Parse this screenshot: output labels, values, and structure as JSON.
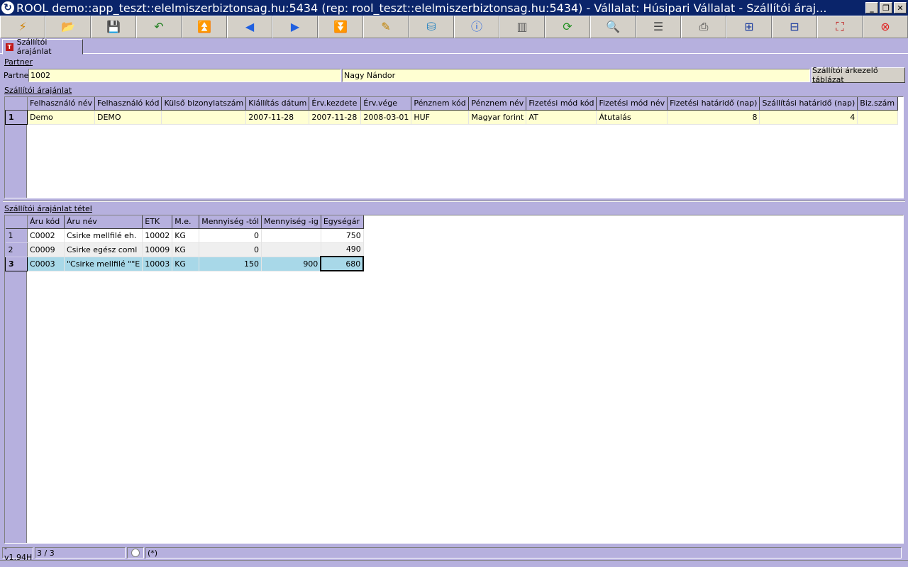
{
  "window": {
    "title": "ROOL demo::app_teszt::elelmiszerbiztonsag.hu:5434 (rep: rool_teszt::elelmiszerbiztonsag.hu:5434) - Vállalat: Húsipari Vállalat - Szállítói áraj...",
    "minimize": "_",
    "restore": "❐",
    "close": "✕"
  },
  "toolbar": [
    {
      "name": "wizard-icon",
      "glyph": "⚡",
      "color": "#d08000"
    },
    {
      "name": "open-folder-icon",
      "glyph": "📂",
      "color": "#2060c0"
    },
    {
      "name": "save-icon",
      "glyph": "💾",
      "color": "#204080"
    },
    {
      "name": "undo-icon",
      "glyph": "↶",
      "color": "#208020"
    },
    {
      "name": "first-record-icon",
      "glyph": "⏫",
      "color": "#2060e0"
    },
    {
      "name": "previous-record-icon",
      "glyph": "◀",
      "color": "#2060e0"
    },
    {
      "name": "next-record-icon",
      "glyph": "▶",
      "color": "#2060e0"
    },
    {
      "name": "last-record-icon",
      "glyph": "⏬",
      "color": "#2060e0"
    },
    {
      "name": "edit-icon",
      "glyph": "✎",
      "color": "#c08000"
    },
    {
      "name": "database-icon",
      "glyph": "⛁",
      "color": "#2080c0"
    },
    {
      "name": "info-icon",
      "glyph": "ⓘ",
      "color": "#2060e0"
    },
    {
      "name": "columns-icon",
      "glyph": "▥",
      "color": "#606060"
    },
    {
      "name": "refresh-icon",
      "glyph": "⟳",
      "color": "#209020"
    },
    {
      "name": "search-icon",
      "glyph": "🔍",
      "color": "#404040"
    },
    {
      "name": "rows-icon",
      "glyph": "☰",
      "color": "#404040"
    },
    {
      "name": "print-icon",
      "glyph": "⎙",
      "color": "#404040"
    },
    {
      "name": "export-grid-icon",
      "glyph": "⊞",
      "color": "#2040a0"
    },
    {
      "name": "import-grid-icon",
      "glyph": "⊟",
      "color": "#2040a0"
    },
    {
      "name": "fullscreen-icon",
      "glyph": "⛶",
      "color": "#c02020"
    },
    {
      "name": "exit-icon",
      "glyph": "⊗",
      "color": "#e02020"
    }
  ],
  "tab": {
    "label": "Szállítói árajánlat"
  },
  "partner": {
    "section_label": "Partner",
    "field_label": "Partner",
    "code": "1002",
    "name": "Nagy Nándor",
    "button": "Szállítói árkezelő táblázat"
  },
  "offer": {
    "section_label": "Szállítói árajánlat",
    "columns": [
      "Felhasználó név",
      "Felhasználó kód",
      "Külső bizonylatszám",
      "Kiállítás dátum",
      "Érv.kezdete",
      "Érv.vége",
      "Pénznem kód",
      "Pénznem név",
      "Fizetési mód kód",
      "Fizetési mód név",
      "Fizetési határidő (nap)",
      "Szállítási határidő (nap)",
      "Biz.szám"
    ],
    "rows": [
      {
        "num": "1",
        "cells": [
          "Demo",
          "DEMO",
          "",
          "2007-11-28",
          "2007-11-28",
          "2008-03-01",
          "HUF",
          "Magyar forint",
          "AT",
          "Átutalás",
          "8",
          "4",
          ""
        ]
      }
    ]
  },
  "items": {
    "section_label": "Szállítói árajánlat tétel",
    "columns": [
      "Áru kód",
      "Áru név",
      "ETK",
      "M.e.",
      "Mennyiség -tól",
      "Mennyiség -ig",
      "Egységár"
    ],
    "rows": [
      {
        "num": "1",
        "cells": [
          "C0002",
          "Csirke mellfilé eh.",
          "10002",
          "KG",
          "0",
          "",
          "750"
        ]
      },
      {
        "num": "2",
        "cells": [
          "C0009",
          "Csirke egész coml",
          "10009",
          "KG",
          "0",
          "",
          "490"
        ]
      },
      {
        "num": "3",
        "cells": [
          "C0003",
          "\"Csirke mellfilé \"\"E",
          "10003",
          "KG",
          "150",
          "900",
          "680"
        ]
      }
    ]
  },
  "status": {
    "version": "-v1.94H",
    "record": "3 / 3",
    "flag": "(*)"
  }
}
